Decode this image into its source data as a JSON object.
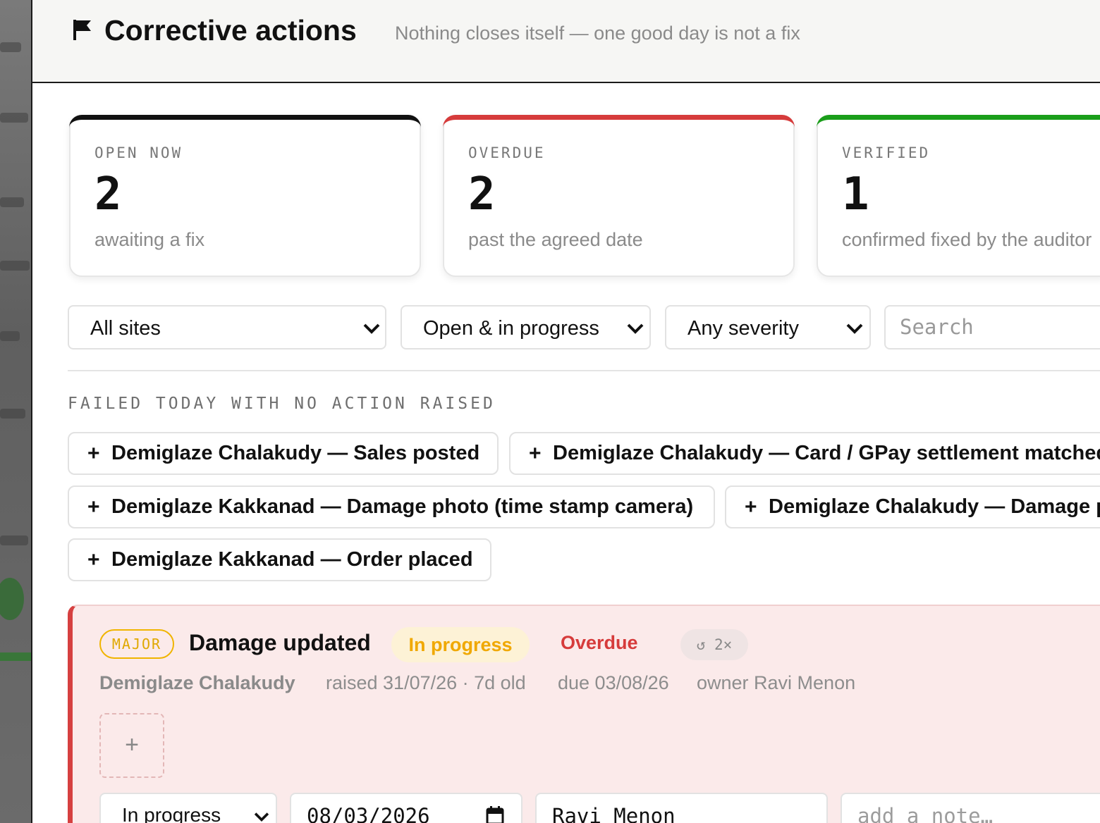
{
  "header": {
    "icon": "flag-icon",
    "title": "Corrective actions",
    "subtitle": "Nothing closes itself — one good day is not a fix"
  },
  "summary": {
    "open": {
      "label": "OPEN NOW",
      "value": "2",
      "sub": "awaiting a fix",
      "accent": "#111111"
    },
    "overdue": {
      "label": "OVERDUE",
      "value": "2",
      "sub": "past the agreed date",
      "accent": "#d63b3b"
    },
    "verified": {
      "label": "VERIFIED",
      "value": "1",
      "sub": "confirmed fixed by the auditor",
      "accent": "#1a9e1a"
    }
  },
  "filters": {
    "site": "All sites",
    "status": "Open & in progress",
    "severity": "Any severity",
    "search_placeholder": "Search"
  },
  "failed_section": {
    "label": "FAILED TODAY WITH NO ACTION RAISED",
    "chips": [
      "Demiglaze Chalakudy — Sales posted",
      "Demiglaze Chalakudy — Card / GPay settlement matched",
      "Demiglaze Kakkanad — Damage photo (time stamp camera)",
      "Demiglaze Chalakudy — Damage photo (time stamp camera)",
      "Demiglaze Kakkanad — Order placed"
    ]
  },
  "action": {
    "severity": "MAJOR",
    "title": "Damage updated",
    "status": "In progress",
    "overdue_label": "Overdue",
    "repeat": "↺ 2×",
    "site": "Demiglaze Chalakudy",
    "raised": "raised 31/07/26 · 7d old",
    "due": "due 03/08/26",
    "owner": "owner Ravi Menon",
    "add_photo": "+",
    "status_select": "In progress",
    "due_date_value": "08/03/2026",
    "owner_value": "Ravi Menon",
    "note_placeholder": "add a note…"
  }
}
